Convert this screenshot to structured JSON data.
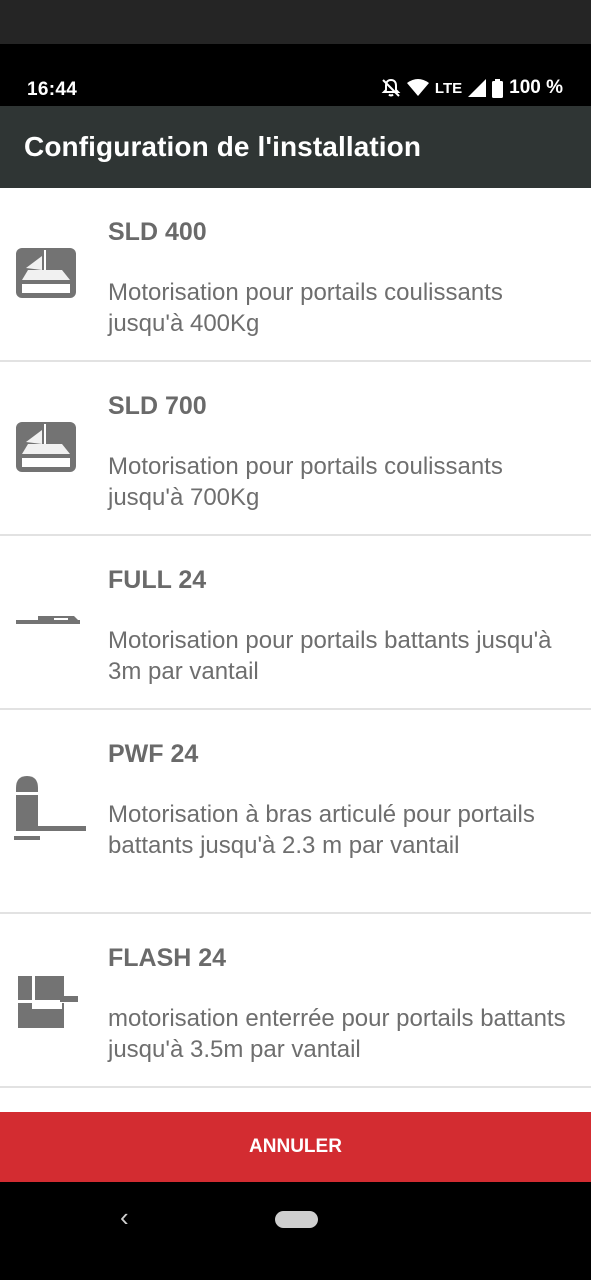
{
  "status_bar": {
    "time": "16:44",
    "network": "LTE",
    "battery": "100 %",
    "icons": [
      "notifications-off-icon",
      "wifi-icon",
      "signal-icon",
      "battery-icon"
    ]
  },
  "app_bar": {
    "title": "Configuration de l'installation"
  },
  "items": [
    {
      "title": "SLD 400",
      "description": "Motorisation pour portails coulissants jusqu'à 400Kg",
      "icon": "sliding-gate-motor-icon"
    },
    {
      "title": "SLD 700",
      "description": "Motorisation pour portails coulissants jusqu'à 700Kg",
      "icon": "sliding-gate-motor-icon"
    },
    {
      "title": "FULL 24",
      "description": "Motorisation pour portails battants jusqu'à 3m par vantail",
      "icon": "swing-arm-motor-icon"
    },
    {
      "title": "PWF 24",
      "description": "Motorisation à bras articulé pour portails battants jusqu'à 2.3 m par vantail",
      "icon": "articulated-arm-motor-icon"
    },
    {
      "title": "FLASH 24",
      "description": "motorisation enterrée pour portails battants jusqu'à 3.5m par vantail",
      "icon": "underground-motor-icon"
    }
  ],
  "cancel_button": {
    "label": "ANNULER"
  },
  "colors": {
    "app_bar": "#2f3534",
    "cancel": "#d32c31",
    "text": "#6a6a6a",
    "divider": "#e2e2e2"
  }
}
